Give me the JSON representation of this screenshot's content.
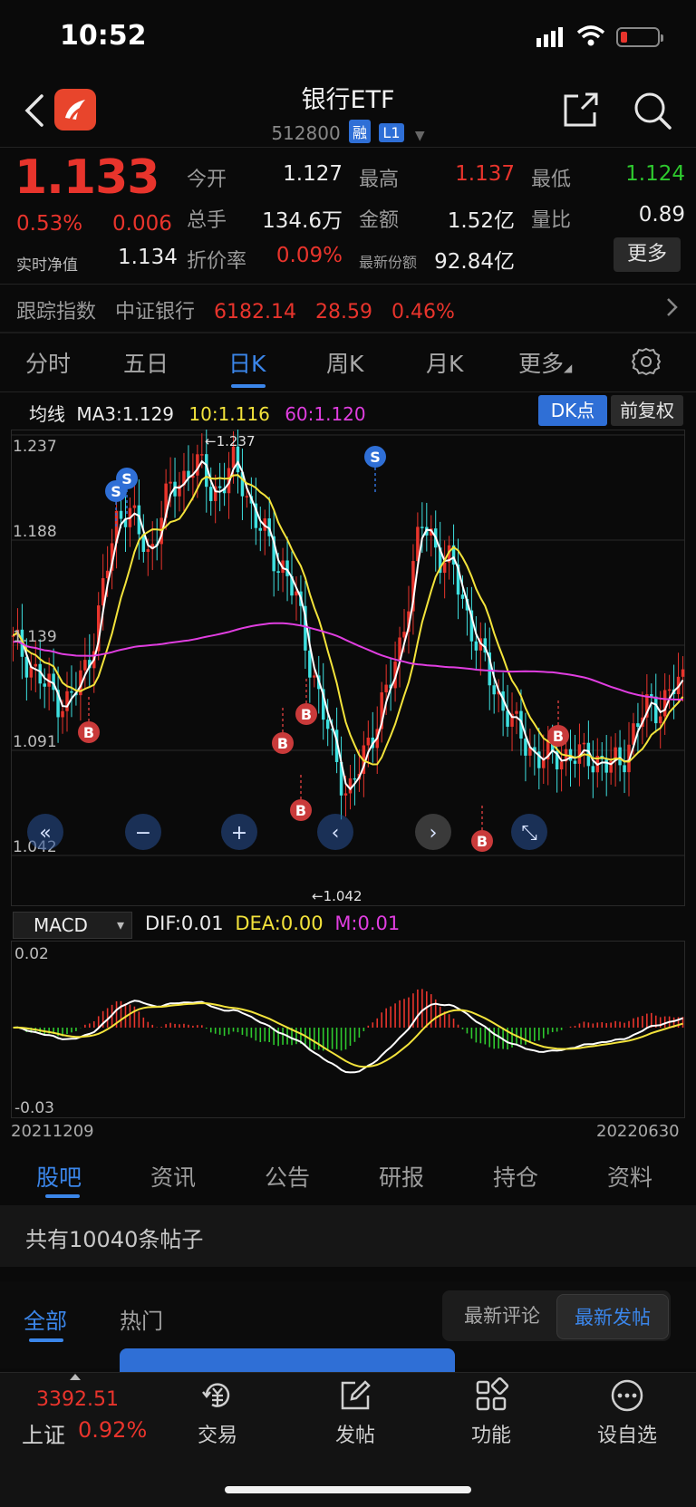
{
  "status_bar": {
    "time": "10:52"
  },
  "header": {
    "title": "银行ETF",
    "code": "512800",
    "tags": [
      "融",
      "L1"
    ]
  },
  "quote": {
    "price": "1.133",
    "change_pct": "0.53%",
    "change": "0.006",
    "nav_label": "实时净值",
    "nav_value": "1.134",
    "open_label": "今开",
    "open": "1.127",
    "high_label": "最高",
    "high": "1.137",
    "low_label": "最低",
    "low": "1.124",
    "volume_label": "总手",
    "volume": "134.6万",
    "amount_label": "金额",
    "amount": "1.52亿",
    "vol_ratio_label": "量比",
    "vol_ratio": "0.89",
    "discount_label": "折价率",
    "discount": "0.09%",
    "shares_label": "最新份额",
    "shares": "92.84亿",
    "more_label": "更多"
  },
  "tracking": {
    "label": "跟踪指数",
    "index_name": "中证银行",
    "index_value": "6182.14",
    "index_change": "28.59",
    "index_pct": "0.46%"
  },
  "period_tabs": [
    "分时",
    "五日",
    "日K",
    "周K",
    "月K",
    "更多"
  ],
  "active_period": "日K",
  "ma_legend": {
    "label": "均线",
    "ma3": "MA3:1.129",
    "ma10": "10:1.116",
    "ma60": "60:1.120",
    "dk_label": "DK点",
    "adjust_label": "前复权"
  },
  "colors": {
    "up": "#e8342c",
    "down": "#3ee0e0",
    "ma3": "#ffffff",
    "ma10": "#f3e33b",
    "ma60": "#e03ee0",
    "accent": "#3b86ea"
  },
  "kline_chart": {
    "type": "candlestick",
    "y_ticks": [
      "1.237",
      "1.188",
      "1.139",
      "1.091",
      "1.042"
    ],
    "ylim": [
      1.042,
      1.237
    ],
    "high_marker": "←1.237",
    "low_marker": "←1.042",
    "signals": [
      "S",
      "S",
      "S",
      "B",
      "B",
      "B",
      "B",
      "B",
      "B"
    ],
    "ctrl_icons": [
      "double-left-icon",
      "zoom-out-icon",
      "zoom-in-icon",
      "left-icon",
      "right-icon",
      "fullscreen-icon"
    ]
  },
  "macd": {
    "selector": "MACD",
    "dif": "DIF:0.01",
    "dea": "DEA:0.00",
    "m": "M:0.01",
    "y_top": "0.02",
    "y_bottom": "-0.03"
  },
  "chart_data": {
    "type": "candlestick",
    "x_start": "20211209",
    "x_end": "20220630",
    "ylim": [
      1.042,
      1.237
    ],
    "close_path": [
      1.14,
      1.136,
      1.128,
      1.12,
      1.117,
      1.112,
      1.118,
      1.13,
      1.15,
      1.175,
      1.2,
      1.205,
      1.19,
      1.18,
      1.2,
      1.21,
      1.215,
      1.225,
      1.22,
      1.21,
      1.215,
      1.222,
      1.215,
      1.2,
      1.19,
      1.18,
      1.175,
      1.16,
      1.14,
      1.12,
      1.1,
      1.085,
      1.07,
      1.08,
      1.095,
      1.11,
      1.12,
      1.14,
      1.17,
      1.195,
      1.19,
      1.18,
      1.175,
      1.16,
      1.145,
      1.13,
      1.12,
      1.11,
      1.1,
      1.095,
      1.088,
      1.085,
      1.09,
      1.088,
      1.086,
      1.09,
      1.085,
      1.082,
      1.087,
      1.095,
      1.105,
      1.115,
      1.11,
      1.118,
      1.125
    ],
    "ma60_endpoints": [
      1.14,
      1.12
    ],
    "dates": [
      "20211209",
      "20220630"
    ]
  },
  "content_tabs": [
    "股吧",
    "资讯",
    "公告",
    "研报",
    "持仓",
    "资料"
  ],
  "posts": {
    "count_text": "共有10040条帖子",
    "filter_all": "全部",
    "filter_hot": "热门",
    "sort_reply": "最新评论",
    "sort_post": "最新发帖"
  },
  "bottom_nav": {
    "index_value": "3392.51",
    "index_name": "上证",
    "index_pct": "0.92%",
    "items": [
      "交易",
      "发帖",
      "功能",
      "设自选"
    ]
  }
}
